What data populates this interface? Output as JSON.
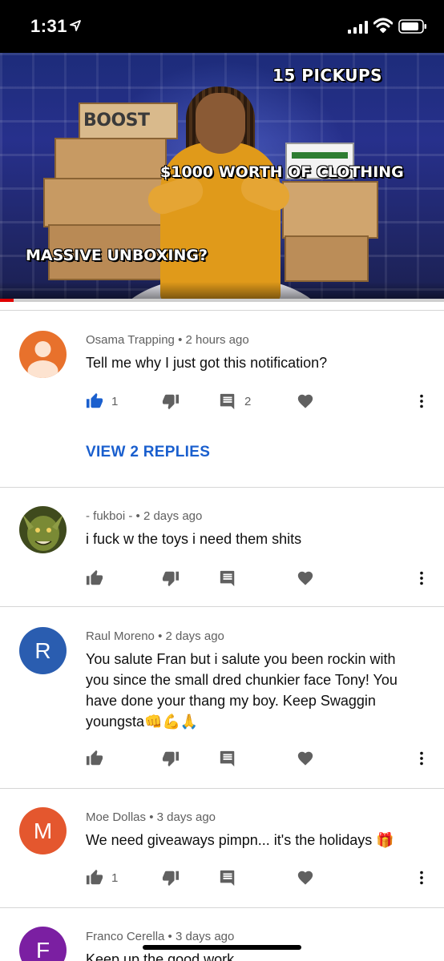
{
  "status_bar": {
    "time": "1:31"
  },
  "video": {
    "overlay_pickups": "15 PICKUPS",
    "overlay_clothing": "$1000 WORTH OF CLOTHING",
    "overlay_unboxing": "MASSIVE UNBOXING?",
    "box_label": "BOOST",
    "progress_fraction": 0.03,
    "progress_color": "#e00000"
  },
  "comments": [
    {
      "author": "Osama Trapping",
      "time": "2 hours ago",
      "text": "Tell me why I just got this notification?",
      "likes": "1",
      "replies": "2",
      "liked": true,
      "view_replies": "VIEW 2 REPLIES",
      "avatar": {
        "type": "default-person",
        "color": "#e8712c"
      }
    },
    {
      "author": "- fukboi -",
      "time": "2 days ago",
      "text": "i fuck w the toys i need them shits",
      "likes": "",
      "replies": "",
      "liked": false,
      "avatar": {
        "type": "photo",
        "color": "#5a6b2a"
      }
    },
    {
      "author": "Raul Moreno",
      "time": "2 days ago",
      "text": "You salute Fran but i salute you been rockin with you since the small dred chunkier face Tony! You have done your thang my boy. Keep Swaggin youngsta👊💪🙏",
      "likes": "",
      "replies": "",
      "liked": false,
      "avatar": {
        "type": "letter",
        "letter": "R",
        "color": "#2a5db0"
      }
    },
    {
      "author": "Moe Dollas",
      "time": "3 days ago",
      "text": "We need giveaways pimpn...  it's the holidays 🎁",
      "likes": "1",
      "replies": "",
      "liked": false,
      "avatar": {
        "type": "letter",
        "letter": "M",
        "color": "#e4572e"
      }
    },
    {
      "author": "Franco Cerella",
      "time": "3 days ago",
      "text": "Keep up the good work",
      "likes": "",
      "replies": "",
      "liked": false,
      "avatar": {
        "type": "letter",
        "letter": "F",
        "color": "#7b1fa2"
      }
    }
  ],
  "icons": {
    "like": "thumbs-up-icon",
    "dislike": "thumbs-down-icon",
    "reply": "reply-icon",
    "heart": "heart-icon",
    "more": "more-vert-icon"
  },
  "colors": {
    "accent_blue": "#1a5fce",
    "icon_gray": "#606060"
  }
}
